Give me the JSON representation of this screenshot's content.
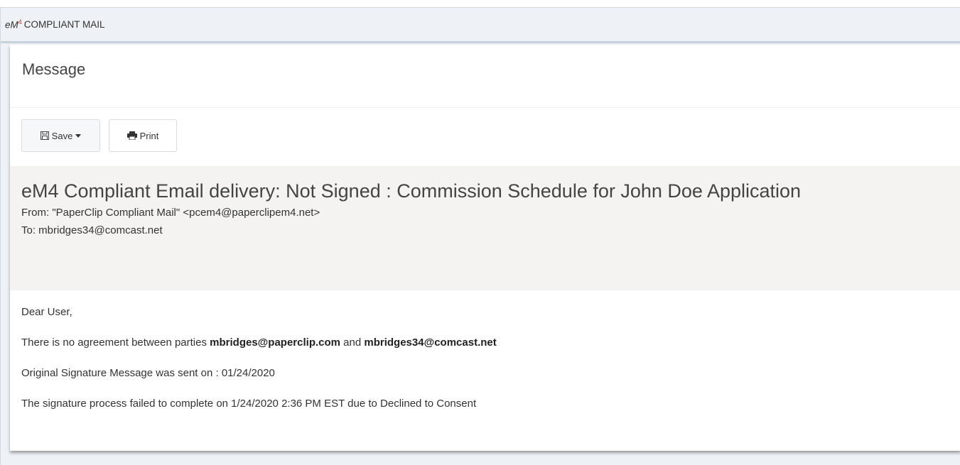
{
  "app": {
    "brand_prefix": "eM",
    "brand_sup": "4",
    "brand_name": "COMPLIANT MAIL"
  },
  "panel": {
    "title": "Message"
  },
  "toolbar": {
    "save_label": "Save",
    "save_icon": "floppy-disk-icon",
    "print_label": "Print",
    "print_icon": "printer-icon"
  },
  "email": {
    "subject": "eM4 Compliant Email delivery: Not Signed : Commission Schedule for John Doe Application",
    "from_line": "From: \"PaperClip Compliant Mail\" <pcem4@paperclipem4.net>",
    "to_line": "To: mbridges34@comcast.net",
    "body": {
      "greeting": "Dear User,",
      "agreement_prefix": "There is no agreement between parties ",
      "party_1": "mbridges@paperclip.com",
      "agreement_and": " and ",
      "party_2": "mbridges34@comcast.net",
      "original_sent": "Original Signature Message was sent on : 01/24/2020",
      "failure_line": "The signature process failed to complete on 1/24/2020 2:36 PM EST due to Declined to Consent"
    }
  }
}
